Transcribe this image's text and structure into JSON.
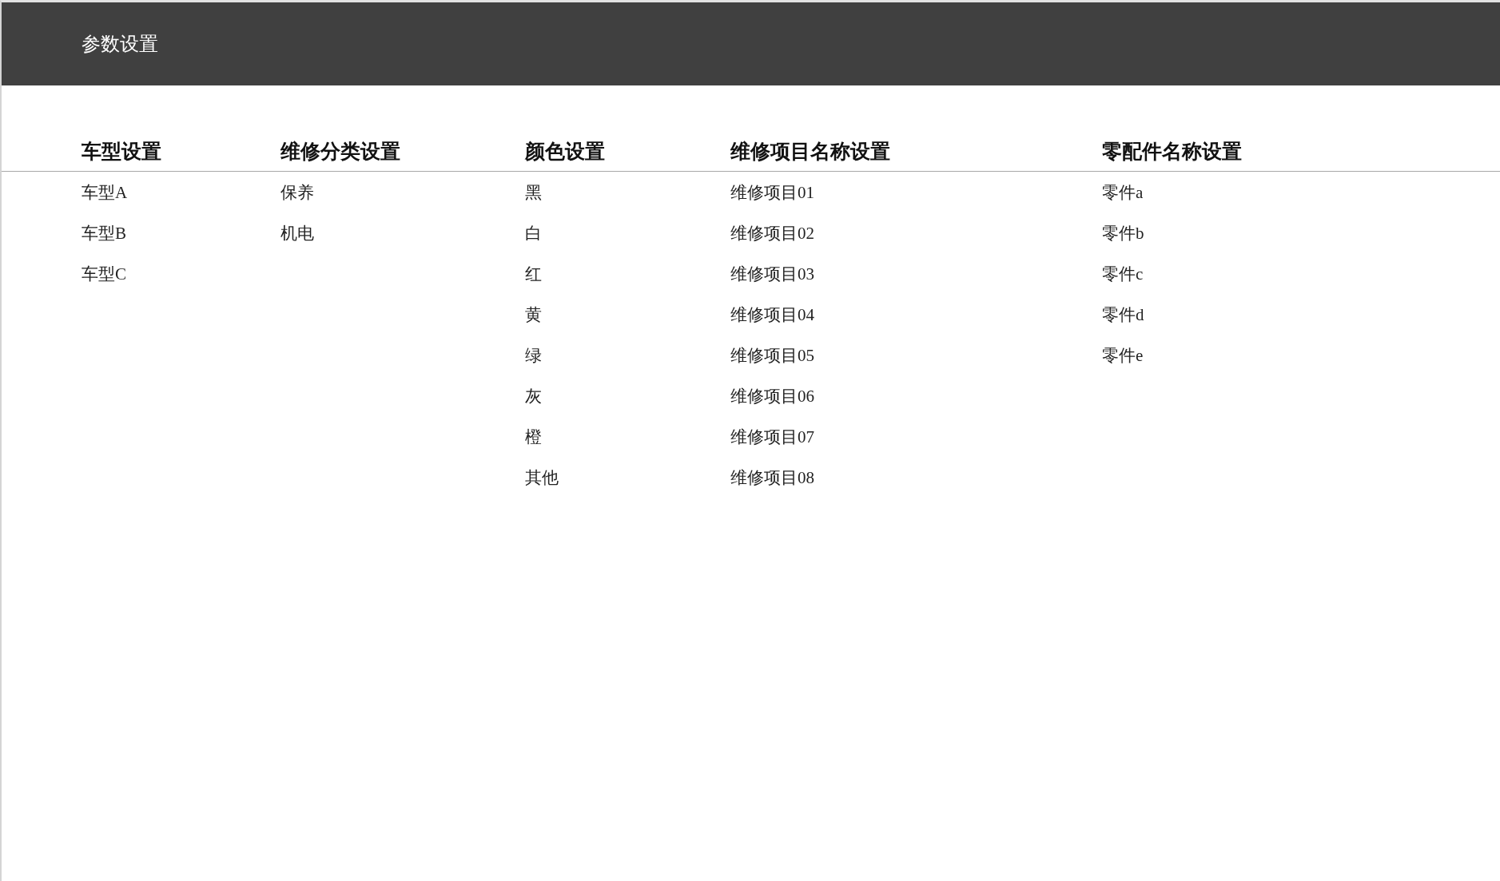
{
  "title": "参数设置",
  "columns": [
    {
      "heading": "车型设置",
      "items": [
        "车型A",
        "车型B",
        "车型C"
      ]
    },
    {
      "heading": "维修分类设置",
      "items": [
        "保养",
        "机电"
      ]
    },
    {
      "heading": "颜色设置",
      "items": [
        "黑",
        "白",
        "红",
        "黄",
        "绿",
        "灰",
        "橙",
        "其他"
      ]
    },
    {
      "heading": "维修项目名称设置",
      "items": [
        "维修项目01",
        "维修项目02",
        "维修项目03",
        "维修项目04",
        "维修项目05",
        "维修项目06",
        "维修项目07",
        "维修项目08"
      ]
    },
    {
      "heading": "零配件名称设置",
      "items": [
        "零件a",
        "零件b",
        "零件c",
        "零件d",
        "零件e"
      ]
    }
  ]
}
